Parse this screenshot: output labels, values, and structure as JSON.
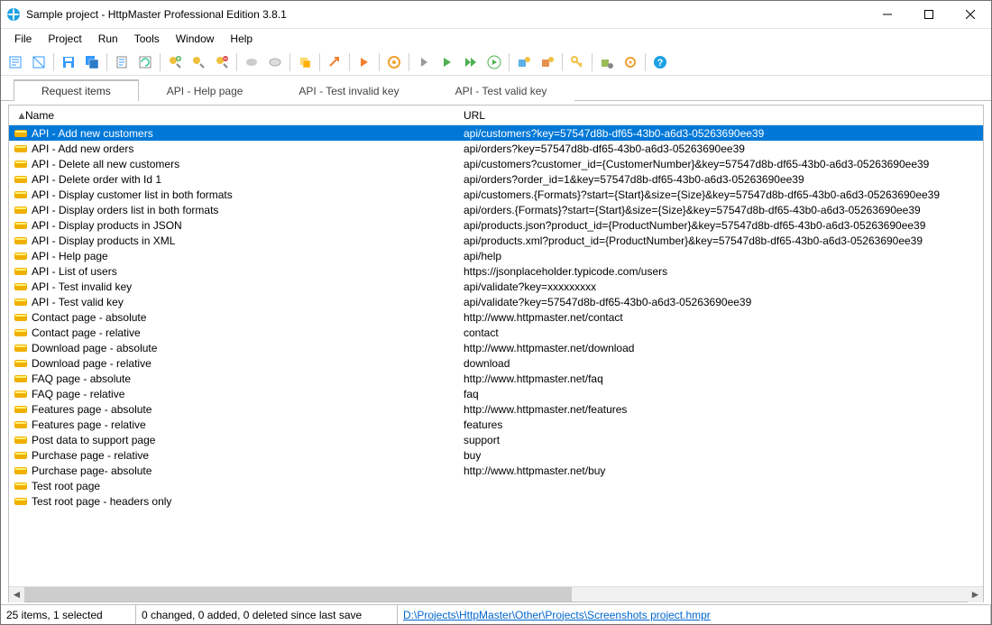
{
  "window": {
    "title": "Sample project - HttpMaster Professional Edition 3.8.1"
  },
  "menus": [
    "File",
    "Project",
    "Run",
    "Tools",
    "Window",
    "Help"
  ],
  "tabs": [
    {
      "label": "Request items",
      "active": true
    },
    {
      "label": "API - Help page",
      "active": false
    },
    {
      "label": "API - Test invalid key",
      "active": false
    },
    {
      "label": "API - Test valid key",
      "active": false
    }
  ],
  "columns": {
    "name": "Name",
    "url": "URL"
  },
  "rows": [
    {
      "name": "API - Add new customers",
      "url": "api/customers?key=57547d8b-df65-43b0-a6d3-05263690ee39",
      "selected": true
    },
    {
      "name": "API - Add new orders",
      "url": "api/orders?key=57547d8b-df65-43b0-a6d3-05263690ee39"
    },
    {
      "name": "API - Delete all new customers",
      "url": "api/customers?customer_id={CustomerNumber}&key=57547d8b-df65-43b0-a6d3-05263690ee39"
    },
    {
      "name": "API - Delete order with Id 1",
      "url": "api/orders?order_id=1&key=57547d8b-df65-43b0-a6d3-05263690ee39"
    },
    {
      "name": "API - Display customer list in both formats",
      "url": "api/customers.{Formats}?start={Start}&size={Size}&key=57547d8b-df65-43b0-a6d3-05263690ee39"
    },
    {
      "name": "API - Display orders list in both formats",
      "url": "api/orders.{Formats}?start={Start}&size={Size}&key=57547d8b-df65-43b0-a6d3-05263690ee39"
    },
    {
      "name": "API - Display products in JSON",
      "url": "api/products.json?product_id={ProductNumber}&key=57547d8b-df65-43b0-a6d3-05263690ee39"
    },
    {
      "name": "API - Display products in XML",
      "url": "api/products.xml?product_id={ProductNumber}&key=57547d8b-df65-43b0-a6d3-05263690ee39"
    },
    {
      "name": "API - Help page",
      "url": "api/help"
    },
    {
      "name": "API - List of users",
      "url": "https://jsonplaceholder.typicode.com/users"
    },
    {
      "name": "API - Test invalid key",
      "url": "api/validate?key=xxxxxxxxx"
    },
    {
      "name": "API - Test valid key",
      "url": "api/validate?key=57547d8b-df65-43b0-a6d3-05263690ee39"
    },
    {
      "name": "Contact page - absolute",
      "url": "http://www.httpmaster.net/contact"
    },
    {
      "name": "Contact page - relative",
      "url": "contact"
    },
    {
      "name": "Download page - absolute",
      "url": "http://www.httpmaster.net/download"
    },
    {
      "name": "Download page - relative",
      "url": "download"
    },
    {
      "name": "FAQ page - absolute",
      "url": "http://www.httpmaster.net/faq"
    },
    {
      "name": "FAQ page - relative",
      "url": "faq"
    },
    {
      "name": "Features page - absolute",
      "url": "http://www.httpmaster.net/features"
    },
    {
      "name": "Features page - relative",
      "url": "features"
    },
    {
      "name": "Post data to support page",
      "url": "support"
    },
    {
      "name": "Purchase page - relative",
      "url": "buy"
    },
    {
      "name": "Purchase page- absolute",
      "url": "http://www.httpmaster.net/buy"
    },
    {
      "name": "Test root page",
      "url": ""
    },
    {
      "name": "Test root page - headers only",
      "url": ""
    }
  ],
  "status": {
    "items": "25 items, 1 selected",
    "changes": "0 changed, 0 added, 0 deleted since last save",
    "path": "D:\\Projects\\HttpMaster\\Other\\Projects\\Screenshots project.hmpr"
  }
}
